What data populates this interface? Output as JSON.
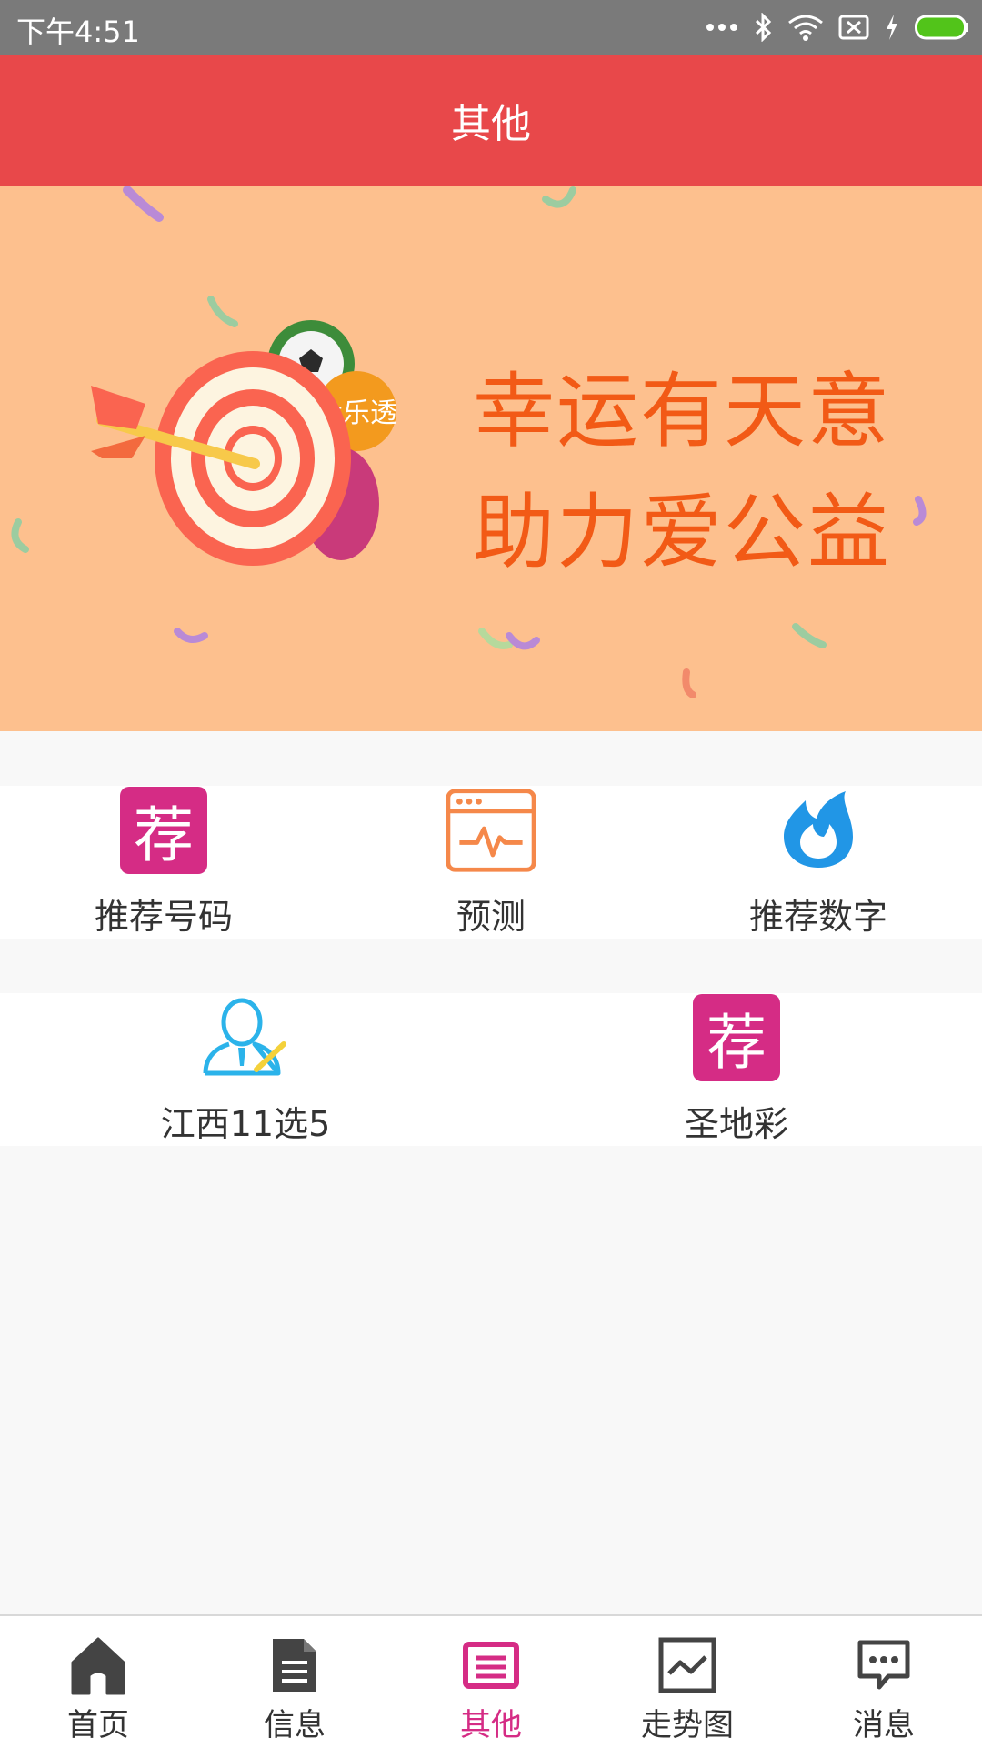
{
  "status_bar": {
    "time": "下午4:51"
  },
  "app_bar": {
    "title": "其他"
  },
  "banner": {
    "line1": "幸运有天意",
    "line2": "助力爱公益",
    "ball_text": "大乐透"
  },
  "grid": {
    "row1": [
      {
        "label": "推荐号码",
        "icon": "recommend-icon",
        "badge": "荐"
      },
      {
        "label": "预测",
        "icon": "chart-window-icon"
      },
      {
        "label": "推荐数字",
        "icon": "flame-icon"
      }
    ],
    "row2": [
      {
        "label": "江西11选5",
        "icon": "person-edit-icon"
      },
      {
        "label": "圣地彩",
        "icon": "recommend-icon",
        "badge": "荐"
      }
    ]
  },
  "bottom_nav": {
    "items": [
      {
        "label": "首页",
        "icon": "home-icon"
      },
      {
        "label": "信息",
        "icon": "document-icon"
      },
      {
        "label": "其他",
        "icon": "list-icon",
        "active": true
      },
      {
        "label": "走势图",
        "icon": "trend-chart-icon"
      },
      {
        "label": "消息",
        "icon": "message-icon"
      }
    ]
  },
  "colors": {
    "status_bar": "#7a7a7a",
    "app_bar": "#e8484a",
    "banner_bg": "#fdc08e",
    "slogan": "#f25a16",
    "accent": "#d52c85",
    "forecast_icon": "#f5884a",
    "flame_icon": "#2196e6",
    "person_icon": "#2bb3ea"
  }
}
